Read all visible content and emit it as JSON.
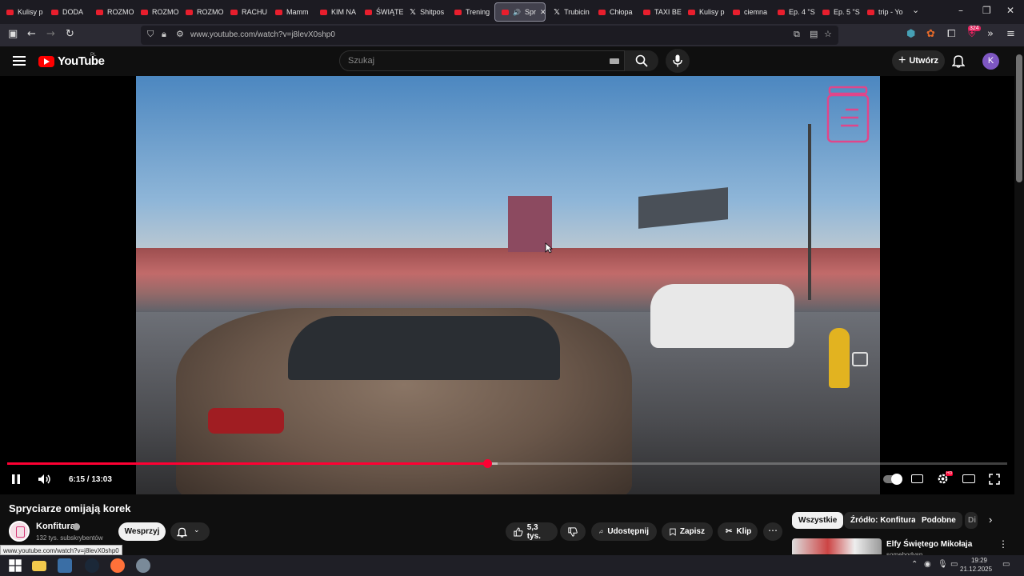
{
  "browser": {
    "tabs": [
      {
        "label": "Kulisy p",
        "icon": "youtube-icon"
      },
      {
        "label": "DODA",
        "icon": "youtube-icon"
      },
      {
        "label": "ROZMO",
        "icon": "youtube-icon"
      },
      {
        "label": "ROZMO",
        "icon": "youtube-icon"
      },
      {
        "label": "ROZMO",
        "icon": "youtube-icon"
      },
      {
        "label": "RACHU",
        "icon": "youtube-icon"
      },
      {
        "label": "Mamm",
        "icon": "youtube-icon"
      },
      {
        "label": "KIM NA",
        "icon": "youtube-icon"
      },
      {
        "label": "ŚWIĄTE",
        "icon": "youtube-icon"
      },
      {
        "label": "Shitpos",
        "icon": "x-icon"
      },
      {
        "label": "Trening",
        "icon": "youtube-icon"
      },
      {
        "label": "Spr",
        "icon": "youtube-icon",
        "active": true
      },
      {
        "label": "Trubicin",
        "icon": "x-icon"
      },
      {
        "label": "Chłopa",
        "icon": "youtube-icon"
      },
      {
        "label": "TAXI BE",
        "icon": "youtube-icon"
      },
      {
        "label": "Kulisy p",
        "icon": "youtube-icon"
      },
      {
        "label": "ciemna",
        "icon": "youtube-icon"
      },
      {
        "label": "Ep. 4 \"S",
        "icon": "youtube-icon"
      },
      {
        "label": "Ep. 5 \"S",
        "icon": "youtube-icon"
      },
      {
        "label": "trip - Yo",
        "icon": "youtube-icon"
      }
    ],
    "url": "www.youtube.com/watch?v=j8levX0shp0",
    "extension_badge": "324",
    "status_url": "www.youtube.com/watch?v=j8levX0shp0"
  },
  "youtube": {
    "wordmark": "YouTube",
    "region": "PL",
    "search_placeholder": "Szukaj",
    "create_label": "Utwórz",
    "avatar_letter": "K"
  },
  "player": {
    "time": "6:15 / 13:03",
    "played_fraction": 0.48,
    "buffered_fraction": 0.49,
    "hd_badge": "HD"
  },
  "video": {
    "title": "Spryciarze omijają korek",
    "channel": "Konfitura",
    "subscribers": "132 tys. subskrybentów",
    "support_label": "Wesprzyj",
    "likes": "5,3 tys.",
    "share_label": "Udostępnij",
    "save_label": "Zapisz",
    "clip_label": "Klip"
  },
  "recommendations": {
    "chips": [
      "Wszystkie",
      "Źródło: Konfitura",
      "Podobne",
      "Di"
    ],
    "first": {
      "title": "Elfy Świętego Mikołaja",
      "channel": "somebodysp"
    }
  },
  "taskbar": {
    "time": "19:29",
    "date": "21.12.2025"
  },
  "colors": {
    "accent": "#ff0033",
    "background": "#0f0f0f",
    "avatar": "#7e57c2"
  }
}
